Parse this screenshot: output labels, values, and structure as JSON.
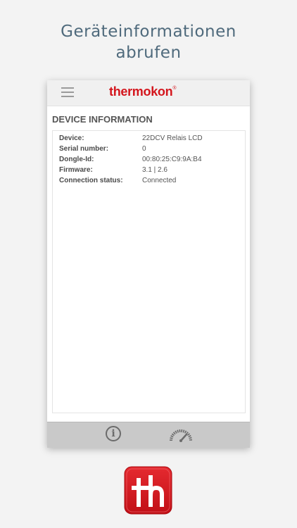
{
  "headline": {
    "line1": "Geräteinformationen",
    "line2": "abrufen"
  },
  "app": {
    "brand": "thermokon",
    "brand_mark": "®",
    "menu_icon": "hamburger-menu-icon",
    "section_title": "DEVICE INFORMATION",
    "rows": [
      {
        "label": "Device:",
        "value": "22DCV Relais LCD"
      },
      {
        "label": "Serial number:",
        "value": "0"
      },
      {
        "label": "Dongle-Id:",
        "value": "00:80:25:C9:9A:B4"
      },
      {
        "label": "Firmware:",
        "value": "3.1 | 2.6"
      },
      {
        "label": "Connection status:",
        "value": "Connected"
      }
    ],
    "bottom_nav": {
      "info_icon": "info-icon",
      "info_glyph": "i",
      "gauge_icon": "gauge-icon"
    }
  },
  "logo": {
    "text": "th",
    "color": "#d4161d"
  },
  "colors": {
    "accent": "#d4161d",
    "headline": "#4f6a7c",
    "appbar": "#f0f0f0",
    "bottombar": "#c9c9c9"
  }
}
